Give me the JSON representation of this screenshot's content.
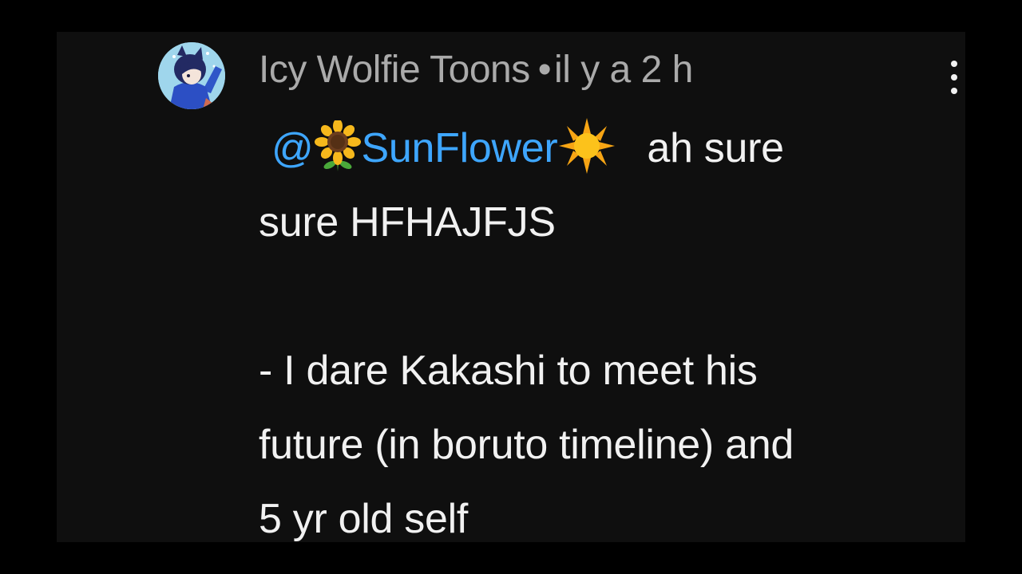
{
  "comment": {
    "author": "Icy Wolfie Toons",
    "separator": "•",
    "timestamp": "il y a 2 h",
    "mention_at": "@",
    "mention_name": "SunFlower",
    "mention_prefix_emoji": "sunflower-emoji",
    "mention_suffix_emoji": "sun-emoji",
    "text_line1_tail": "ah sure",
    "text_line2": "sure HFHAJFJS",
    "text_line3": "- I dare Kakashi to meet his",
    "text_line4": "future (in boruto timeline) and",
    "text_line5": "5 yr old self"
  },
  "icons": {
    "more": "more-vertical-icon",
    "avatar": "avatar"
  },
  "colors": {
    "background": "#0f0f0f",
    "outer_background": "#000000",
    "author_text": "#aaaaaa",
    "body_text": "#f1f1f1",
    "mention": "#3ea6ff"
  }
}
